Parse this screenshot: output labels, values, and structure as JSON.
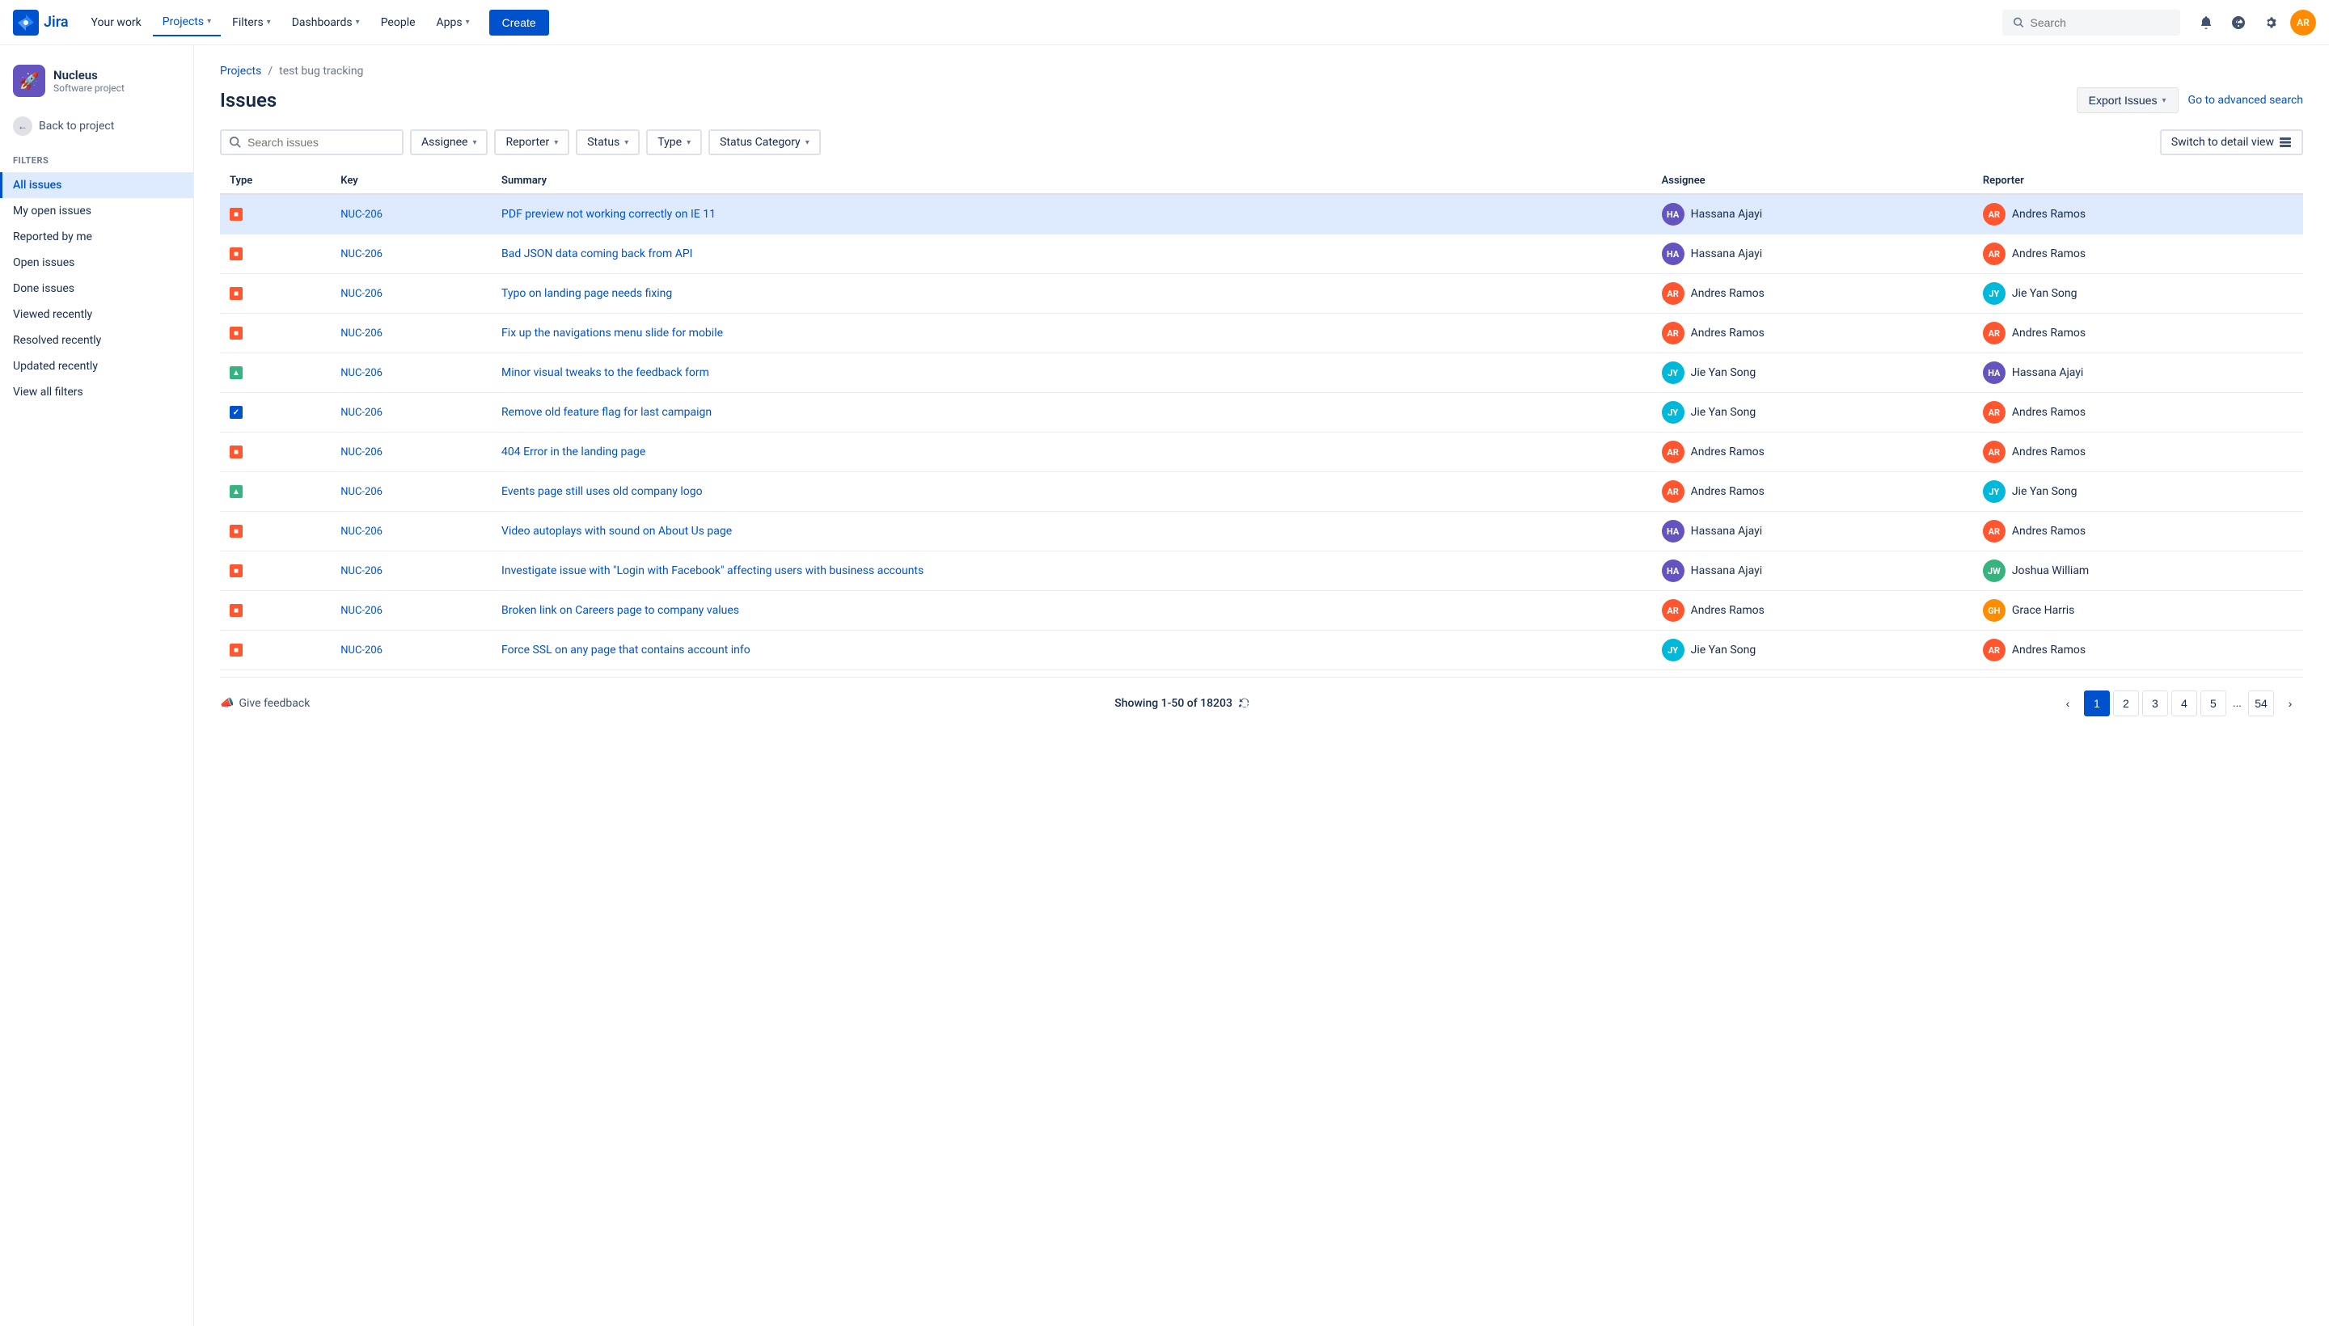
{
  "topnav": {
    "logo_text": "Jira",
    "nav_items": [
      {
        "label": "Your work",
        "active": false
      },
      {
        "label": "Projects",
        "active": true
      },
      {
        "label": "Filters",
        "active": false
      },
      {
        "label": "Dashboards",
        "active": false
      },
      {
        "label": "People",
        "active": false
      },
      {
        "label": "Apps",
        "active": false
      }
    ],
    "create_label": "Create",
    "search_placeholder": "Search"
  },
  "sidebar": {
    "project_name": "Nucleus",
    "project_type": "Software project",
    "back_label": "Back to project",
    "section_label": "Filters",
    "nav_items": [
      {
        "label": "All issues",
        "active": true
      },
      {
        "label": "My open issues",
        "active": false
      },
      {
        "label": "Reported by me",
        "active": false
      },
      {
        "label": "Open issues",
        "active": false
      },
      {
        "label": "Done issues",
        "active": false
      },
      {
        "label": "Viewed recently",
        "active": false
      },
      {
        "label": "Resolved recently",
        "active": false
      },
      {
        "label": "Updated recently",
        "active": false
      },
      {
        "label": "View all filters",
        "active": false
      }
    ]
  },
  "breadcrumb": {
    "projects_label": "Projects",
    "separator": "/",
    "current": "test bug tracking"
  },
  "page": {
    "title": "Issues",
    "export_label": "Export Issues",
    "advanced_search_label": "Go to advanced search"
  },
  "filters": {
    "search_placeholder": "Search issues",
    "assignee_label": "Assignee",
    "reporter_label": "Reporter",
    "status_label": "Status",
    "type_label": "Type",
    "status_category_label": "Status Category",
    "detail_view_label": "Switch to detail view"
  },
  "table": {
    "columns": [
      "Type",
      "Key",
      "Summary",
      "Assignee",
      "Reporter"
    ],
    "rows": [
      {
        "type": "bug",
        "key": "NUC-206",
        "summary": "PDF preview not working correctly on IE 11",
        "assignee": "Hassana Ajayi",
        "assignee_color": "#6554C0",
        "reporter": "Andres Ramos",
        "reporter_color": "#FF5630",
        "selected": true
      },
      {
        "type": "bug",
        "key": "NUC-206",
        "summary": "Bad JSON data coming back from API",
        "assignee": "Hassana Ajayi",
        "assignee_color": "#6554C0",
        "reporter": "Andres Ramos",
        "reporter_color": "#FF5630",
        "selected": false
      },
      {
        "type": "bug",
        "key": "NUC-206",
        "summary": "Typo on landing page needs fixing",
        "assignee": "Andres Ramos",
        "assignee_color": "#FF5630",
        "reporter": "Jie Yan Song",
        "reporter_color": "#00B8D9",
        "selected": false
      },
      {
        "type": "bug",
        "key": "NUC-206",
        "summary": "Fix up the navigations menu slide for mobile",
        "assignee": "Andres Ramos",
        "assignee_color": "#FF5630",
        "reporter": "Andres Ramos",
        "reporter_color": "#FF5630",
        "selected": false
      },
      {
        "type": "improvement",
        "key": "NUC-206",
        "summary": "Minor visual tweaks to the feedback form",
        "assignee": "Jie Yan Song",
        "assignee_color": "#00B8D9",
        "reporter": "Hassana Ajayi",
        "reporter_color": "#6554C0",
        "selected": false
      },
      {
        "type": "done",
        "key": "NUC-206",
        "summary": "Remove old feature flag for last campaign",
        "assignee": "Jie Yan Song",
        "assignee_color": "#00B8D9",
        "reporter": "Andres Ramos",
        "reporter_color": "#FF5630",
        "selected": false
      },
      {
        "type": "bug",
        "key": "NUC-206",
        "summary": "404 Error in the landing page",
        "assignee": "Andres Ramos",
        "assignee_color": "#FF5630",
        "reporter": "Andres Ramos",
        "reporter_color": "#FF5630",
        "selected": false
      },
      {
        "type": "improvement",
        "key": "NUC-206",
        "summary": "Events page still uses old company logo",
        "assignee": "Andres Ramos",
        "assignee_color": "#FF5630",
        "reporter": "Jie Yan Song",
        "reporter_color": "#00B8D9",
        "selected": false
      },
      {
        "type": "bug",
        "key": "NUC-206",
        "summary": "Video autoplays with sound on About Us page",
        "assignee": "Hassana Ajayi",
        "assignee_color": "#6554C0",
        "reporter": "Andres Ramos",
        "reporter_color": "#FF5630",
        "selected": false
      },
      {
        "type": "bug",
        "key": "NUC-206",
        "summary": "Investigate issue with \"Login with Facebook\" affecting users with business accounts",
        "assignee": "Hassana Ajayi",
        "assignee_color": "#6554C0",
        "reporter": "Joshua William",
        "reporter_color": "#36B37E",
        "selected": false
      },
      {
        "type": "bug",
        "key": "NUC-206",
        "summary": "Broken link on Careers page to company values",
        "assignee": "Andres Ramos",
        "assignee_color": "#FF5630",
        "reporter": "Grace Harris",
        "reporter_color": "#FF8B00",
        "selected": false
      },
      {
        "type": "bug",
        "key": "NUC-206",
        "summary": "Force SSL on any page that contains account info",
        "assignee": "Jie Yan Song",
        "assignee_color": "#00B8D9",
        "reporter": "Andres Ramos",
        "reporter_color": "#FF5630",
        "selected": false
      }
    ]
  },
  "pagination": {
    "showing_text": "Showing 1-50 of 18203",
    "feedback_label": "Give feedback",
    "pages": [
      1,
      2,
      3,
      4,
      5
    ],
    "ellipsis": "...",
    "last_page": 54,
    "current_page": 1
  },
  "icons": {
    "bug_symbol": "■",
    "improvement_symbol": "▲",
    "done_symbol": "✓",
    "chevron_down": "▾",
    "chevron_left": "‹",
    "chevron_right": "›"
  }
}
